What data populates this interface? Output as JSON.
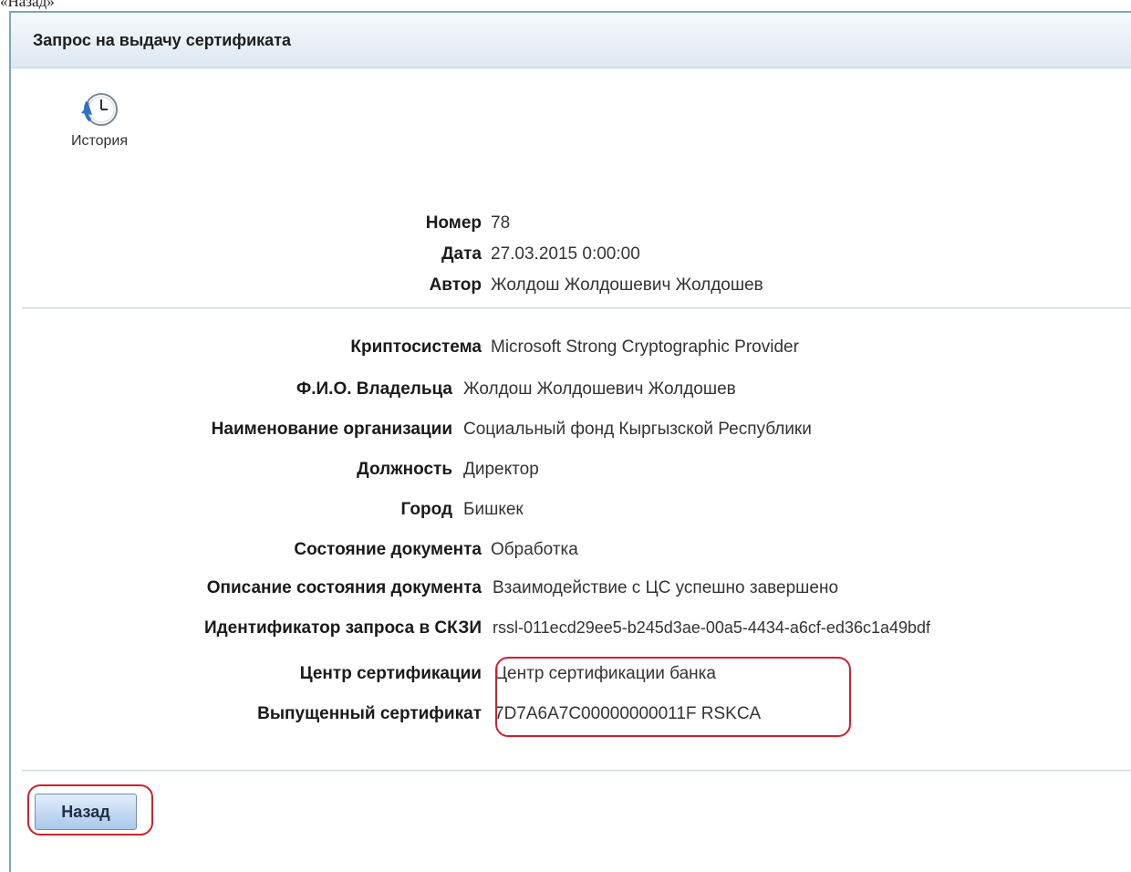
{
  "top_cut_text": "«Назад»",
  "header": {
    "title": "Запрос на выдачу сертификата"
  },
  "toolbar": {
    "history_label": "История",
    "history_icon": "history-clock-icon"
  },
  "meta": [
    {
      "label": "Номер",
      "value": "78"
    },
    {
      "label": "Дата",
      "value": "27.03.2015 0:00:00"
    },
    {
      "label": "Автор",
      "value": "Жолдош Жолдошевич Жолдошев"
    }
  ],
  "fields": [
    {
      "label": "Криптосистема",
      "value": "Microsoft Strong Cryptographic Provider"
    },
    {
      "label": "Ф.И.О. Владельца",
      "value": "Жолдош Жолдошевич Жолдошев"
    },
    {
      "label": "Наименование организации",
      "value": "Социальный фонд Кыргызской Республики"
    },
    {
      "label": "Должность",
      "value": "Директор"
    },
    {
      "label": "Город",
      "value": "Бишкек"
    },
    {
      "label": "Состояние документа",
      "value": "Обработка"
    },
    {
      "label": "Описание состояния документа",
      "value": "Взаимодействие с ЦС успешно завершено"
    },
    {
      "label": "Идентификатор запроса в СКЗИ",
      "value": "rssl-011ecd29ee5-b245d3ae-00a5-4434-a6cf-ed36c1a49bdf"
    },
    {
      "label": "Центр сертификации",
      "value": "Центр сертификации банка"
    },
    {
      "label": "Выпущенный сертификат",
      "value": "7D7A6A7C00000000011F RSKCA"
    }
  ],
  "actions": {
    "back_label": "Назад"
  },
  "colors": {
    "accent_border": "#7fa3bf",
    "highlight": "#d0202a",
    "button": "#a9c8ea"
  }
}
